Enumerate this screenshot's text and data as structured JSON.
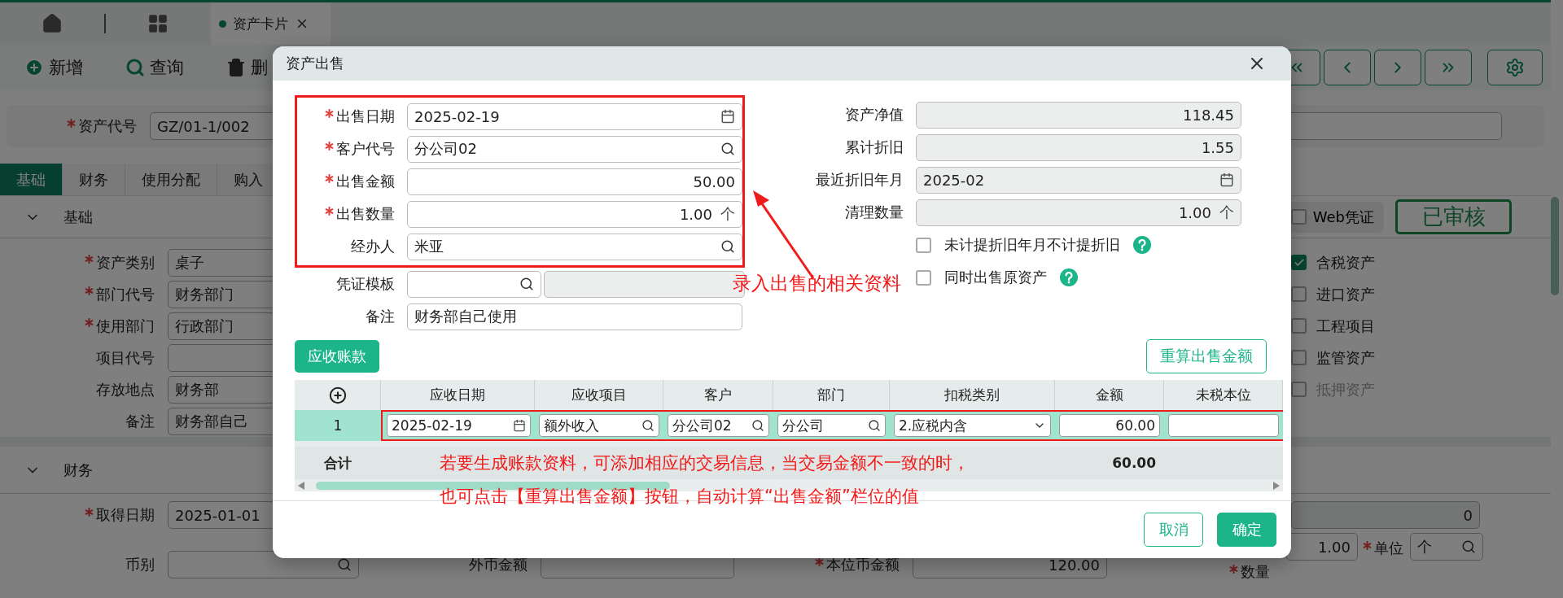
{
  "page": {
    "tab_bar": {
      "tabs": [
        {
          "label": "资产卡片",
          "selected": true
        }
      ]
    },
    "toolbar": [
      {
        "label": "新增",
        "kind": "add"
      },
      {
        "label": "查询",
        "kind": "search"
      },
      {
        "label": "删",
        "kind": "delete"
      }
    ],
    "asset_code": {
      "label": "资产代号",
      "required": true,
      "value": "GZ/01-1/002"
    },
    "section_tabs": [
      {
        "label": "基础",
        "selected": true
      },
      {
        "label": "财务",
        "selected": false
      },
      {
        "label": "使用分配",
        "selected": false
      },
      {
        "label": "购入",
        "selected": false
      }
    ],
    "basic": {
      "title": "基础",
      "voucher_button": "Web凭证",
      "status": "已审核",
      "fields": [
        {
          "label": "资产类别",
          "required": true,
          "value": "桌子"
        },
        {
          "label": "部门代号",
          "required": true,
          "value": "财务部门"
        },
        {
          "label": "使用部门",
          "required": true,
          "value": "行政部门"
        },
        {
          "label": "项目代号",
          "required": false
        },
        {
          "label": "存放地点",
          "required": false,
          "value": "财务部"
        },
        {
          "label": "备注",
          "required": false,
          "value": "财务部自己"
        }
      ],
      "options": [
        {
          "label": "含税资产",
          "checked": true,
          "disabled": false
        },
        {
          "label": "进口资产",
          "checked": false,
          "disabled": false
        },
        {
          "label": "工程项目",
          "checked": false,
          "disabled": false
        },
        {
          "label": "监管资产",
          "checked": false,
          "disabled": false
        },
        {
          "label": "抵押资产",
          "checked": false,
          "disabled": true
        }
      ]
    },
    "finance": {
      "title": "财务",
      "acquired": {
        "label": "取得日期",
        "required": true,
        "value": "2025-01-01"
      },
      "right_value": "0",
      "currency": {
        "label": "币别",
        "required": false
      },
      "foreign_amount": {
        "label": "外币金额",
        "required": false
      },
      "base_amount": {
        "label": "本位币金额",
        "required": true,
        "value": "120.00"
      },
      "quantity": {
        "label": "数量",
        "required": true,
        "value": "1.00"
      },
      "unit": {
        "label": "单位",
        "required": true,
        "value": "个"
      }
    }
  },
  "dialog": {
    "title": "资产出售",
    "sale_fields": [
      {
        "label": "出售日期",
        "required": true,
        "value": "2025-02-19",
        "kind": "date"
      },
      {
        "label": "客户代号",
        "required": true,
        "value": "分公司02",
        "kind": "lookup"
      },
      {
        "label": "出售金额",
        "required": true,
        "value": "50.00",
        "kind": "number"
      },
      {
        "label": "出售数量",
        "required": true,
        "value": "1.00",
        "unit": "个",
        "kind": "number"
      },
      {
        "label": "经办人",
        "required": false,
        "value": "米亚",
        "kind": "lookup"
      }
    ],
    "extra_fields": [
      {
        "label": "凭证模板",
        "kind": "lookup_pair"
      },
      {
        "label": "备注",
        "value": "财务部自己使用",
        "kind": "text"
      }
    ],
    "summary_fields": [
      {
        "label": "资产净值",
        "value": "118.45",
        "kind": "number"
      },
      {
        "label": "累计折旧",
        "value": "1.55",
        "kind": "number"
      },
      {
        "label": "最近折旧年月",
        "value": "2025-02",
        "kind": "date"
      },
      {
        "label": "清理数量",
        "value": "1.00",
        "unit": "个",
        "kind": "number"
      }
    ],
    "options": [
      {
        "label": "未计提折旧年月不计提折旧",
        "checked": false
      },
      {
        "label": "同时出售原资产",
        "checked": false
      }
    ],
    "receivable_button": "应收账款",
    "recalc_button": "重算出售金额",
    "table": {
      "columns": [
        "应收日期",
        "应收项目",
        "客户",
        "部门",
        "扣税类别",
        "金额",
        "未税本位"
      ],
      "rows": [
        {
          "index": "1",
          "cells": [
            {
              "value": "2025-02-19",
              "kind": "date"
            },
            {
              "value": "额外收入",
              "kind": "lookup"
            },
            {
              "value": "分公司02",
              "kind": "lookup"
            },
            {
              "value": "分公司",
              "kind": "lookup"
            },
            {
              "value": "2.应税内含",
              "kind": "select"
            },
            {
              "value": "60.00",
              "kind": "number"
            },
            {
              "kind": "text"
            }
          ]
        }
      ],
      "total": {
        "label": "合计",
        "amount": "60.00"
      }
    },
    "annotations": [
      {
        "lines": [
          "录入出售的相关资料"
        ]
      },
      {
        "lines": [
          "若要生成账款资料，可添加相应的交易信息，当交易金额不一致的时，",
          "也可点击【重算出售金额】按钮，自动计算“出售金额”栏位的值"
        ]
      }
    ],
    "buttons": [
      {
        "label": "取消",
        "kind": "secondary"
      },
      {
        "label": "确定",
        "kind": "primary"
      }
    ]
  }
}
